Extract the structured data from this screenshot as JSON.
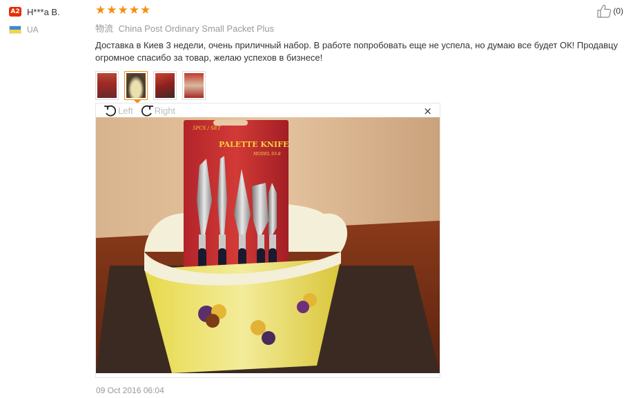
{
  "buyer": {
    "level_badge": "A2",
    "name": "H***a B.",
    "country": "UA"
  },
  "review": {
    "rating": 5,
    "stars": [
      "★",
      "★",
      "★",
      "★",
      "★"
    ],
    "helpful_count": "(0)",
    "logistics_label": "物流",
    "logistics_method": "China Post Ordinary Small Packet Plus",
    "text": "Доставка в Киев 3 недели, очень приличный набор. В работе попробовать еще не успела, но думаю все будет ОК! Продавцу огромное спасибо за товар, желаю успехов в бизнесе!",
    "date": "09 Oct 2016 06:04"
  },
  "viewer": {
    "rotate_left": "Left",
    "rotate_right": "Right",
    "close": "×",
    "package_brand": "PALETTE KNIFE",
    "package_model": "MODEL 93-8",
    "package_pcs": "5PCS / SET"
  },
  "colors": {
    "accent": "#f58e0c",
    "badge": "#e62e04",
    "muted_text": "#999999"
  }
}
